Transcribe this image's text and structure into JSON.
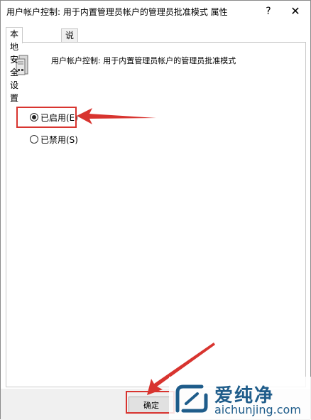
{
  "window": {
    "title": "用户帐户控制: 用于内置管理员帐户的管理员批准模式 属性",
    "help_label": "?",
    "close_label": "✕"
  },
  "tabs": [
    {
      "label": "本地安全设置",
      "active": true
    },
    {
      "label": "说明",
      "active": false
    }
  ],
  "policy": {
    "icon": "server-icon",
    "title": "用户帐户控制: 用于内置管理员帐户的管理员批准模式"
  },
  "options": [
    {
      "label": "已启用(E)",
      "checked": true
    },
    {
      "label": "已禁用(S)",
      "checked": false
    }
  ],
  "footer": {
    "ok_label": "确定"
  },
  "watermark": {
    "name": "爱纯净",
    "url": "aichunjing.com"
  },
  "colors": {
    "annotation_red": "#d8342f",
    "watermark_blue": "#1e5c8a"
  }
}
